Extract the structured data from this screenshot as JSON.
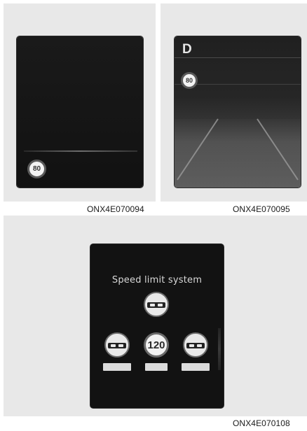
{
  "figures": [
    {
      "caption": "ONX4E070094",
      "badge": "80"
    },
    {
      "caption": "ONX4E070095",
      "gear": "D",
      "badge": "80"
    },
    {
      "caption": "ONX4E070108",
      "title": "Speed limit system",
      "limit_value": "120",
      "plates": [
        "",
        "",
        ""
      ]
    }
  ],
  "colors": {
    "panel_bg": "#e8e8e8",
    "screen_bg": "#121212",
    "sign_white": "#f2f2f2",
    "sign_ring": "#6a6a6a"
  },
  "icons": [
    "no-overtaking-sign-icon",
    "speed-limit-sign-icon",
    "road-perspective-graphic"
  ]
}
